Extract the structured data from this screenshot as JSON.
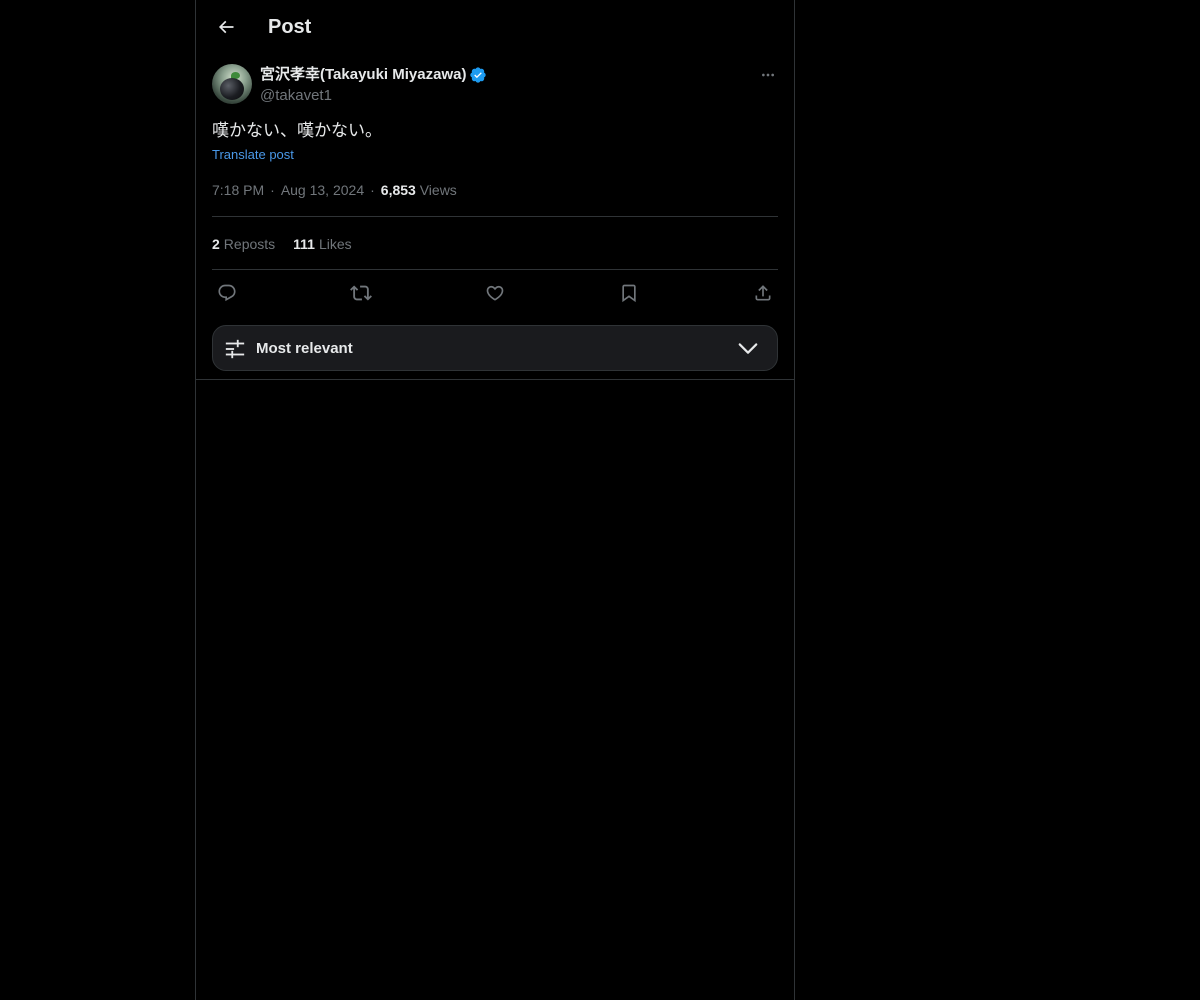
{
  "header": {
    "title": "Post",
    "back_icon": "arrow-left-icon"
  },
  "post": {
    "author": {
      "display_name": "宮沢孝幸(Takayuki Miyazawa)",
      "handle": "@takavet1",
      "verified": true,
      "verified_color": "#1d9bf0"
    },
    "text": "嘆かない、嘆かない。",
    "translate_label": "Translate post",
    "time": "7:18 PM",
    "date": "Aug 13, 2024",
    "views_count": "6,853",
    "views_label": "Views",
    "separator": "·",
    "reposts_count": "2",
    "reposts_label": "Reposts",
    "likes_count": "111",
    "likes_label": "Likes"
  },
  "actions": {
    "icons": [
      "reply-icon",
      "repost-icon",
      "like-icon",
      "bookmark-icon",
      "share-icon"
    ]
  },
  "sort": {
    "label": "Most relevant",
    "icon": "sliders-icon",
    "chevron": "chevron-down-icon"
  },
  "colors": {
    "background": "#000000",
    "text": "#e7e9ea",
    "muted": "#71767b",
    "link": "#4a99e9",
    "border": "#2f3336"
  }
}
